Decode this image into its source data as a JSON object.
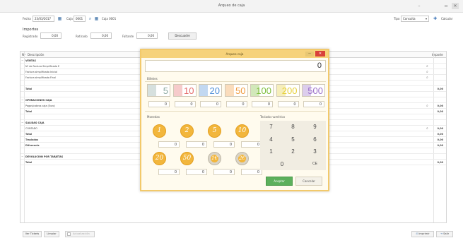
{
  "window": {
    "title": "Arqueo de caja",
    "minimize": "–",
    "maximize": "▫",
    "close": "✕"
  },
  "toolbar": {
    "fecha_label": "Fecha",
    "fecha_value": "23/03/2017",
    "caja_label": "Caja",
    "caja_value": "0001",
    "caja_name": "Caja 0001",
    "tipo_label": "Tipo",
    "tipo_value": "Consulta",
    "calcular_label": "Calcular"
  },
  "importes": {
    "title": "Importes",
    "registro_label": "Registrado",
    "registro_value": "0,00",
    "retirado_label": "Retirado",
    "retirado_value": "0,00",
    "faltante_label": "Faltante",
    "faltante_value": "0,00",
    "descuadre_label": "Descuadre"
  },
  "table": {
    "col_num": "Nº",
    "col_desc": "Descripción",
    "col_importe": "Importe",
    "rows": [
      {
        "text": "VENTAS",
        "kind": "group",
        "expand": "−",
        "search": false,
        "amount": ""
      },
      {
        "text": "Nº de Factura Simplificada E",
        "kind": "normal",
        "expand": "",
        "search": true,
        "amount": ""
      },
      {
        "text": "Factura simplificada Inicial",
        "kind": "normal",
        "expand": "",
        "search": true,
        "amount": ""
      },
      {
        "text": "Factura simplificada Final",
        "kind": "normal",
        "expand": "",
        "search": true,
        "amount": ""
      },
      {
        "text": "",
        "kind": "normal",
        "expand": "",
        "search": false,
        "amount": ""
      },
      {
        "text": "Total",
        "kind": "bold",
        "expand": "",
        "search": false,
        "amount": "0,00"
      },
      {
        "text": "",
        "kind": "normal",
        "expand": "",
        "search": false,
        "amount": ""
      },
      {
        "text": "OPERACIONES CAJA",
        "kind": "group",
        "expand": "−",
        "search": false,
        "amount": ""
      },
      {
        "text": "Pagos/cobros caja (Euro)",
        "kind": "normal",
        "expand": "",
        "search": true,
        "amount": "0,00"
      },
      {
        "text": "Total",
        "kind": "bold",
        "expand": "",
        "search": false,
        "amount": "0,00"
      },
      {
        "text": "",
        "kind": "normal",
        "expand": "",
        "search": false,
        "amount": ""
      },
      {
        "text": "SALIDAS CAJA",
        "kind": "group",
        "expand": "−",
        "search": false,
        "amount": ""
      },
      {
        "text": "CONTADO",
        "kind": "normal",
        "expand": "",
        "search": true,
        "amount": "0,00"
      },
      {
        "text": "Total",
        "kind": "bold",
        "expand": "",
        "search": false,
        "amount": "0,00"
      },
      {
        "text": "Traslados",
        "kind": "bold",
        "expand": "",
        "search": false,
        "amount": "0,00"
      },
      {
        "text": "Diferencia",
        "kind": "bold",
        "expand": "",
        "search": false,
        "amount": "0,00"
      },
      {
        "text": "",
        "kind": "normal",
        "expand": "",
        "search": false,
        "amount": ""
      },
      {
        "text": "DEVOLUCIÓN POR TARJETAS",
        "kind": "group",
        "expand": "−",
        "search": false,
        "amount": ""
      },
      {
        "text": "Total",
        "kind": "bold",
        "expand": "",
        "search": false,
        "amount": "0,00"
      }
    ]
  },
  "bottom": {
    "btn_ver_tickets": "Ver Tickets",
    "btn_limpiar": "Limpiar",
    "btn_check_label": "Actualización",
    "btn_imprimir": "Imprimir",
    "btn_salir": "Salir"
  },
  "modal": {
    "title": "Arqueo caja",
    "min_label": "—",
    "close_label": "✕",
    "total": "0",
    "billetes_label": "Billetes",
    "monedas_label": "Monedas",
    "teclado_label": "Teclado numérico",
    "bills": [
      {
        "value": "5",
        "color": "#8aa7a0",
        "count": "0"
      },
      {
        "value": "10",
        "color": "#e46b6b",
        "count": "0"
      },
      {
        "value": "20",
        "color": "#4f8fd8",
        "count": "0"
      },
      {
        "value": "50",
        "color": "#f09a3e",
        "count": "0"
      },
      {
        "value": "100",
        "color": "#7dbd3a",
        "count": "0"
      },
      {
        "value": "200",
        "color": "#e6cf3a",
        "count": "0"
      },
      {
        "value": "500",
        "color": "#9b6fc9",
        "count": "0"
      }
    ],
    "coins_row1": [
      {
        "label": "1",
        "silver": false,
        "count": "0"
      },
      {
        "label": "2",
        "silver": false,
        "count": "0"
      },
      {
        "label": "5",
        "silver": false,
        "count": "0"
      },
      {
        "label": "10",
        "silver": false,
        "count": "0"
      }
    ],
    "coins_row2": [
      {
        "label": "20",
        "silver": false,
        "count": "0"
      },
      {
        "label": "50",
        "silver": false,
        "count": "0"
      },
      {
        "label": "1€",
        "silver": true,
        "count": "0"
      },
      {
        "label": "2€",
        "silver": true,
        "count": "0"
      }
    ],
    "keys": [
      "7",
      "8",
      "9",
      "4",
      "5",
      "6",
      "1",
      "2",
      "3",
      "0",
      "CE"
    ],
    "accept_label": "Aceptar",
    "cancel_label": "Cancelar"
  }
}
